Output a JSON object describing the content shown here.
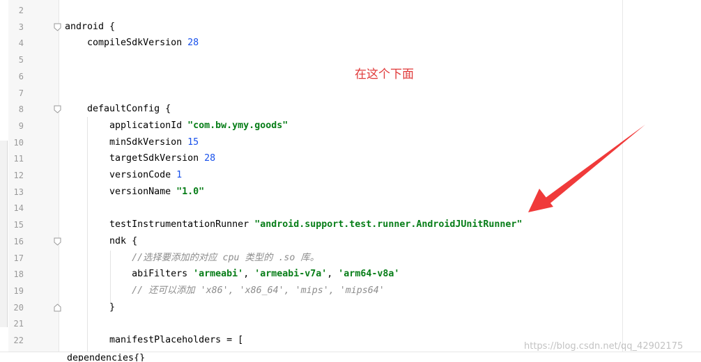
{
  "editor": {
    "lines": [
      {
        "n": "2",
        "parts": []
      },
      {
        "n": "3",
        "parts": [
          {
            "t": "android {",
            "c": ""
          }
        ]
      },
      {
        "n": "4",
        "parts": [
          {
            "t": "    compileSdkVersion ",
            "c": ""
          },
          {
            "t": "28",
            "c": "num"
          }
        ]
      },
      {
        "n": "5",
        "parts": []
      },
      {
        "n": "6",
        "parts": []
      },
      {
        "n": "7",
        "parts": []
      },
      {
        "n": "8",
        "parts": [
          {
            "t": "    defaultConfig {",
            "c": ""
          }
        ]
      },
      {
        "n": "9",
        "parts": [
          {
            "t": "        applicationId ",
            "c": ""
          },
          {
            "t": "\"com.bw.ymy.goods\"",
            "c": "str"
          }
        ]
      },
      {
        "n": "10",
        "parts": [
          {
            "t": "        minSdkVersion ",
            "c": ""
          },
          {
            "t": "15",
            "c": "num"
          }
        ]
      },
      {
        "n": "11",
        "parts": [
          {
            "t": "        targetSdkVersion ",
            "c": ""
          },
          {
            "t": "28",
            "c": "num"
          }
        ]
      },
      {
        "n": "12",
        "parts": [
          {
            "t": "        versionCode ",
            "c": ""
          },
          {
            "t": "1",
            "c": "num"
          }
        ]
      },
      {
        "n": "13",
        "parts": [
          {
            "t": "        versionName ",
            "c": ""
          },
          {
            "t": "\"1.0\"",
            "c": "str"
          }
        ]
      },
      {
        "n": "14",
        "parts": []
      },
      {
        "n": "15",
        "parts": [
          {
            "t": "        testInstrumentationRunner ",
            "c": ""
          },
          {
            "t": "\"android.support.test.runner.AndroidJUnitRunner\"",
            "c": "str"
          }
        ]
      },
      {
        "n": "16",
        "parts": [
          {
            "t": "        ndk {",
            "c": ""
          }
        ]
      },
      {
        "n": "17",
        "parts": [
          {
            "t": "            ",
            "c": ""
          },
          {
            "t": "//选择要添加的对应 cpu 类型的 .so 库。",
            "c": "cmt"
          }
        ]
      },
      {
        "n": "18",
        "parts": [
          {
            "t": "            abiFilters ",
            "c": ""
          },
          {
            "t": "'armeabi'",
            "c": "str"
          },
          {
            "t": ", ",
            "c": ""
          },
          {
            "t": "'armeabi-v7a'",
            "c": "str"
          },
          {
            "t": ", ",
            "c": ""
          },
          {
            "t": "'arm64-v8a'",
            "c": "str"
          }
        ]
      },
      {
        "n": "19",
        "parts": [
          {
            "t": "            ",
            "c": ""
          },
          {
            "t": "// 还可以添加 'x86', 'x86_64', 'mips', 'mips64'",
            "c": "cmt"
          }
        ]
      },
      {
        "n": "20",
        "parts": [
          {
            "t": "        }",
            "c": ""
          }
        ]
      },
      {
        "n": "21",
        "parts": []
      },
      {
        "n": "22",
        "parts": [
          {
            "t": "        manifestPlaceholders = [",
            "c": ""
          }
        ]
      }
    ],
    "fold_lines": [
      "3",
      "8",
      "16",
      "20"
    ],
    "bottom_text": "dependencies{}"
  },
  "annotation": {
    "text": "在这个下面",
    "color": "#e03a3a"
  },
  "watermark": "https://blog.csdn.net/qq_42902175",
  "colors": {
    "number": "#1750eb",
    "string": "#067d17",
    "comment": "#8c8c8c"
  }
}
